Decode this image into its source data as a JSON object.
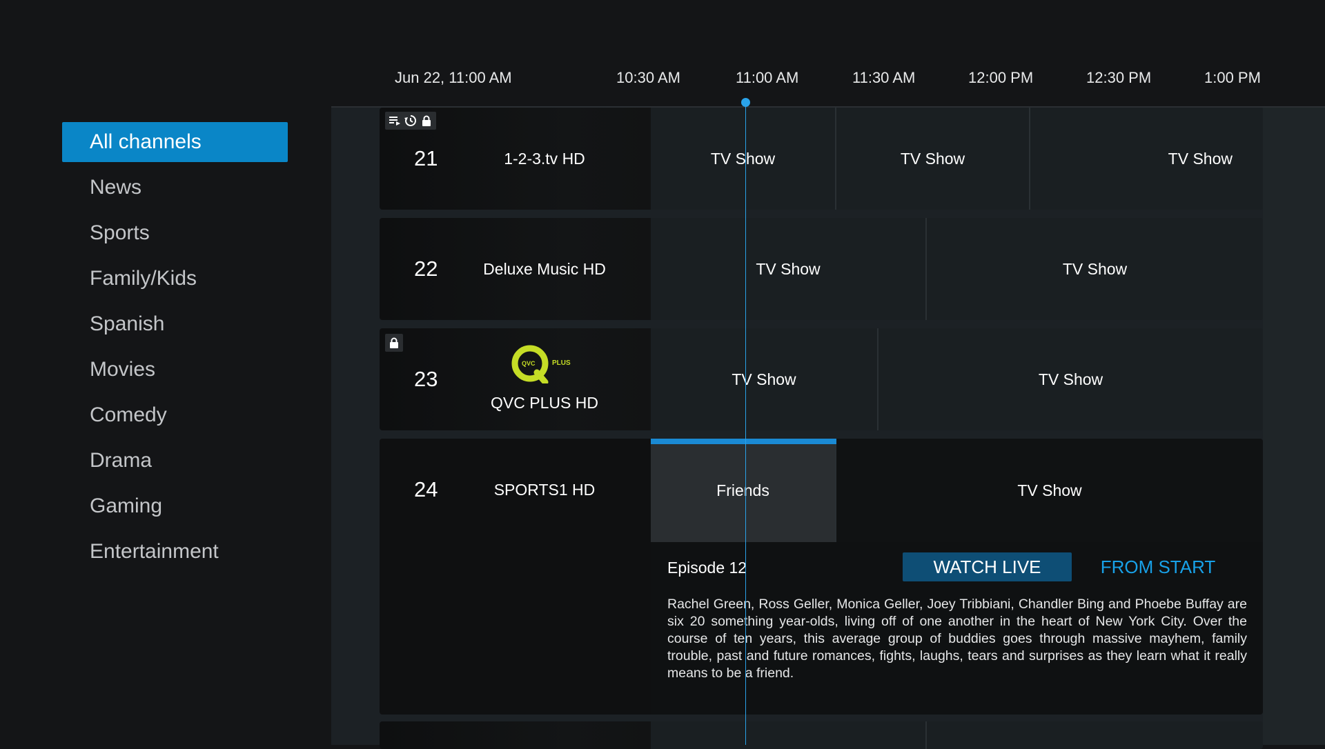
{
  "categories": [
    {
      "label": "All channels",
      "active": true
    },
    {
      "label": "News"
    },
    {
      "label": "Sports"
    },
    {
      "label": "Family/Kids"
    },
    {
      "label": "Spanish"
    },
    {
      "label": "Movies"
    },
    {
      "label": "Comedy"
    },
    {
      "label": "Drama"
    },
    {
      "label": "Gaming"
    },
    {
      "label": "Entertainment"
    }
  ],
  "timeline": {
    "current": "Jun 22, 11:00 AM",
    "slots": [
      "10:30 AM",
      "11:00 AM",
      "11:30 AM",
      "12:00 PM",
      "12:30 PM",
      "1:00 PM"
    ]
  },
  "channels": [
    {
      "number": "21",
      "name": "1-2-3.tv HD",
      "programs": [
        "TV Show",
        "TV Show",
        "TV Show"
      ]
    },
    {
      "number": "22",
      "name": "Deluxe Music HD",
      "programs": [
        "TV Show",
        "TV Show"
      ]
    },
    {
      "number": "23",
      "name": "QVC PLUS HD",
      "logo": {
        "q": "QVC",
        "plus": "PLUS"
      },
      "programs": [
        "TV Show",
        "TV Show"
      ]
    },
    {
      "number": "24",
      "name": "SPORTS1 HD",
      "programs": [
        "Friends",
        "TV Show"
      ]
    }
  ],
  "details": {
    "episode": "Episode 12",
    "watch_live": "WATCH LIVE",
    "from_start": "FROM START",
    "synopsis": "Rachel Green, Ross Geller, Monica Geller, Joey Tribbiani, Chandler Bing and Phoebe Buffay are six 20 something year-olds, living off of one another in the heart of New York City. Over the course of ten years, this average group of buddies goes through massive mayhem, family trouble, past and future romances, fights, laughs, tears and surprises as they learn what it really means to be a friend."
  },
  "colors": {
    "accent": "#0a86c7",
    "link": "#18a1e8",
    "now_line": "#2aa3ea",
    "qvc_green": "#c5dd26"
  },
  "icons": [
    "list-icon",
    "history-icon",
    "lock-icon"
  ]
}
